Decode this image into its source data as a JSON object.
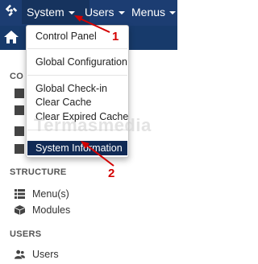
{
  "topbar": {
    "menus": [
      {
        "label": "System"
      },
      {
        "label": "Users"
      },
      {
        "label": "Menus"
      }
    ]
  },
  "system_dropdown": {
    "items": [
      {
        "label": "Control Panel"
      },
      {
        "label": "Global Configuration"
      },
      {
        "label": "Global Check-in"
      },
      {
        "label": "Clear Cache"
      },
      {
        "label": "Clear Expired Cache"
      },
      {
        "label": "System Information"
      }
    ],
    "active_item": "System Information"
  },
  "sidebar": {
    "partial_heading": "CO",
    "structure_heading": "STRUCTURE",
    "structure_items": [
      {
        "label": "Menu(s)",
        "icon": "list-icon"
      },
      {
        "label": "Modules",
        "icon": "cube-icon"
      }
    ],
    "users_heading": "USERS",
    "users_items": [
      {
        "label": "Users",
        "icon": "users-icon"
      }
    ]
  },
  "watermark": "Termasmedia",
  "annotations": {
    "marker_1": "1",
    "marker_2": "2",
    "color": "#d40000"
  },
  "colors": {
    "topbar": "#1c3d72",
    "subbar": "#173a6b",
    "active_highlight": "#112a55"
  }
}
